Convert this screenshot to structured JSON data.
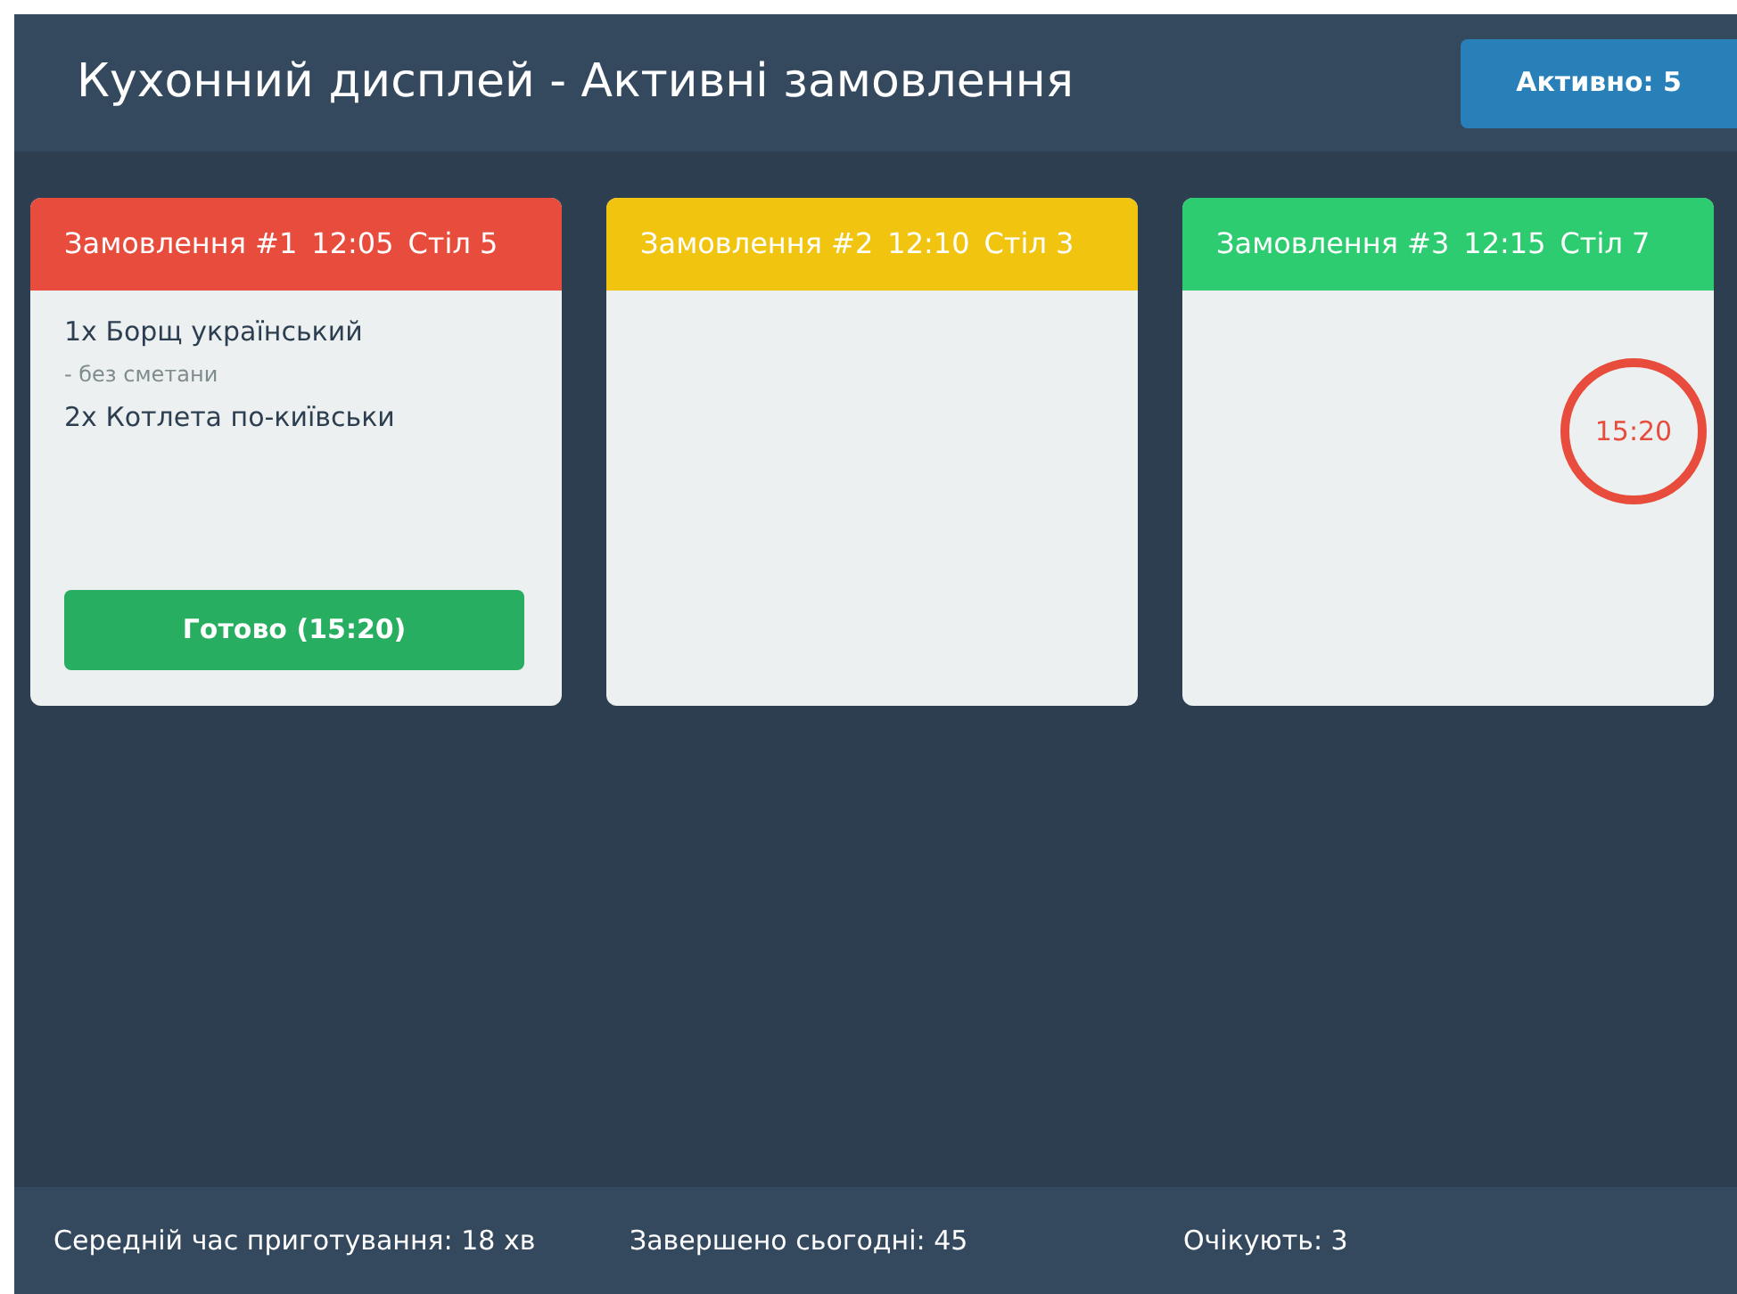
{
  "header": {
    "title": "Кухонний дисплей - Активні замовлення",
    "badge": "Активно: 5"
  },
  "orders": [
    {
      "title": "Замовлення #1",
      "time": "12:05",
      "table": "Стіл 5",
      "color": "#e74c3c",
      "items": [
        {
          "kind": "item",
          "text": "1x Борщ український"
        },
        {
          "kind": "note",
          "text": "- без сметани"
        },
        {
          "kind": "item",
          "text": "2x Котлета по-київськи"
        }
      ],
      "button": "Готово (15:20)"
    },
    {
      "title": "Замовлення #2",
      "time": "12:10",
      "table": "Стіл 3",
      "color": "#f1c40f"
    },
    {
      "title": "Замовлення #3",
      "time": "12:15",
      "table": "Стіл 7",
      "color": "#2ecc71",
      "timer": "15:20"
    }
  ],
  "footer": [
    "Середній час приготування: 18 хв",
    "Завершено сьогодні: 45",
    "Очікують: 3"
  ]
}
